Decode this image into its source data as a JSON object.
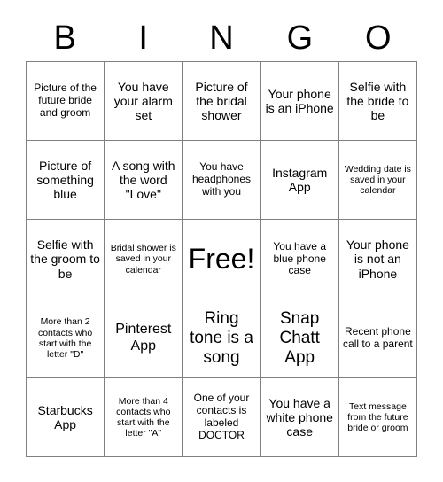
{
  "card": {
    "header_letters": [
      "B",
      "I",
      "N",
      "G",
      "O"
    ],
    "rows": [
      [
        {
          "text": "Picture of the future bride and groom",
          "size": "s"
        },
        {
          "text": "You have your alarm set",
          "size": "m"
        },
        {
          "text": "Picture of the bridal shower",
          "size": "m"
        },
        {
          "text": "Your phone is an iPhone",
          "size": "m"
        },
        {
          "text": "Selfie with the bride to be",
          "size": "m"
        }
      ],
      [
        {
          "text": "Picture of something blue",
          "size": "m"
        },
        {
          "text": "A song with the word \"Love\"",
          "size": "m"
        },
        {
          "text": "You have headphones with you",
          "size": "s"
        },
        {
          "text": "Instagram App",
          "size": "m"
        },
        {
          "text": "Wedding date is saved in your calendar",
          "size": "xs"
        }
      ],
      [
        {
          "text": "Selfie with the groom to be",
          "size": "m"
        },
        {
          "text": "Bridal shower is saved in your calendar",
          "size": "xs"
        },
        {
          "text": "Free!",
          "size": "free"
        },
        {
          "text": "You have a blue phone case",
          "size": "s"
        },
        {
          "text": "Your phone is not an iPhone",
          "size": "m"
        }
      ],
      [
        {
          "text": "More than 2 contacts who start with the letter \"D\"",
          "size": "xs"
        },
        {
          "text": "Pinterest App",
          "size": "l"
        },
        {
          "text": "Ring tone is a song",
          "size": "xl"
        },
        {
          "text": "Snap Chatt App",
          "size": "xl"
        },
        {
          "text": "Recent phone call to a parent",
          "size": "s"
        }
      ],
      [
        {
          "text": "Starbucks App",
          "size": "m"
        },
        {
          "text": "More than 4 contacts who start with the letter \"A\"",
          "size": "xs"
        },
        {
          "text": "One of your contacts is labeled DOCTOR",
          "size": "s"
        },
        {
          "text": "You have a white phone case",
          "size": "m"
        },
        {
          "text": "Text message from the future bride or groom",
          "size": "xs"
        }
      ]
    ],
    "colors": {
      "background": "#ffffff",
      "border": "#808080",
      "text": "#000000"
    }
  }
}
